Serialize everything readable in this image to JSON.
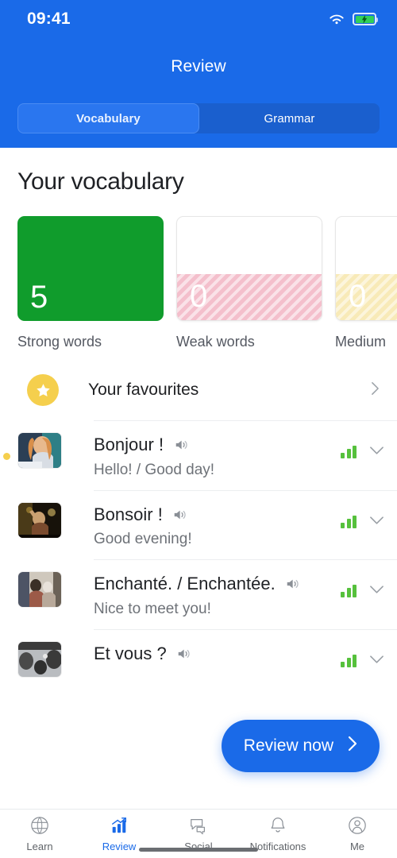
{
  "status_bar": {
    "time": "09:41",
    "wifi_icon": "wifi-icon",
    "battery_icon": "battery-charging-icon"
  },
  "header": {
    "title": "Review",
    "accent_color": "#1a6ae8",
    "tabs": [
      {
        "label": "Vocabulary",
        "active": true
      },
      {
        "label": "Grammar",
        "active": false
      }
    ]
  },
  "main": {
    "section_title": "Your vocabulary",
    "stats": [
      {
        "value": "5",
        "label": "Strong words",
        "style": "solid-green",
        "color": "#109c2c",
        "fill_percent": 100
      },
      {
        "value": "0",
        "label": "Weak words",
        "style": "striped-pink",
        "color": "#f4bfcc",
        "fill_percent": 45
      },
      {
        "value": "0",
        "label": "Medium",
        "style": "striped-yellow",
        "color": "#f8eab8",
        "fill_percent": 45
      }
    ],
    "favourites": {
      "label": "Your favourites",
      "icon": "star-icon",
      "icon_color": "#f5cf4d",
      "chevron": "›"
    },
    "words": [
      {
        "title": "Bonjour !",
        "translation": "Hello! / Good day!",
        "speaker_icon": "speaker-icon",
        "strength_icon": "signal-bars-icon",
        "expand_icon": "chevron-down-icon",
        "favourite_dot": true,
        "thumb_colors": [
          "#2c3e50",
          "#d9a06a",
          "#8fd4d0"
        ]
      },
      {
        "title": "Bonsoir !",
        "translation": "Good evening!",
        "speaker_icon": "speaker-icon",
        "strength_icon": "signal-bars-icon",
        "expand_icon": "chevron-down-icon",
        "favourite_dot": false,
        "thumb_colors": [
          "#1b1405",
          "#6e5a2e",
          "#c9a33d"
        ]
      },
      {
        "title": "Enchanté. / Enchantée.",
        "translation": "Nice to meet you!",
        "speaker_icon": "speaker-icon",
        "strength_icon": "signal-bars-icon",
        "expand_icon": "chevron-down-icon",
        "favourite_dot": false,
        "thumb_colors": [
          "#53596b",
          "#b8a99a",
          "#8a8275"
        ]
      },
      {
        "title": "Et vous ?",
        "translation": "",
        "speaker_icon": "speaker-icon",
        "strength_icon": "signal-bars-icon",
        "expand_icon": "chevron-down-icon",
        "favourite_dot": false,
        "thumb_colors": [
          "#3a3a3a",
          "#7e7e7e",
          "#cfcfcf"
        ]
      }
    ],
    "fab": {
      "label": "Review now",
      "chevron": "›"
    }
  },
  "bottom_nav": [
    {
      "label": "Learn",
      "icon": "globe-icon",
      "active": false
    },
    {
      "label": "Review",
      "icon": "bar-chart-icon",
      "active": true
    },
    {
      "label": "Social",
      "icon": "chat-bubbles-icon",
      "active": false
    },
    {
      "label": "Notifications",
      "icon": "bell-icon",
      "active": false
    },
    {
      "label": "Me",
      "icon": "person-circle-icon",
      "active": false
    }
  ]
}
